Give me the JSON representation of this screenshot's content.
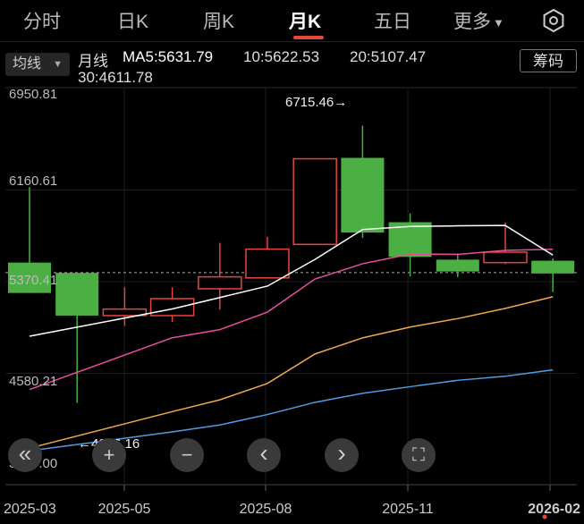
{
  "tabs": [
    {
      "label": "分时",
      "active": false
    },
    {
      "label": "日K",
      "active": false
    },
    {
      "label": "周K",
      "active": false
    },
    {
      "label": "月K",
      "active": true
    },
    {
      "label": "五日",
      "active": false
    },
    {
      "label": "更多",
      "active": false
    }
  ],
  "more_caret": "▼",
  "ma_selector": {
    "label": "均线",
    "caret": "▼"
  },
  "ma_legend": {
    "period": "月线",
    "ma5": "MA5:5631.79",
    "ma10": "10:5622.53",
    "ma20": "20:5107.47",
    "ma30": "30:4611.78"
  },
  "chip_button": "筹码",
  "y_ticks": [
    "6950.81",
    "6160.61",
    "5370.41",
    "4580.21",
    "3790.00"
  ],
  "x_ticks": [
    "2025-03",
    "2025-05",
    "2025-08",
    "2025-11",
    "2026-02"
  ],
  "high_label": "6715.46→",
  "low_label": "←4296.16",
  "controls": {
    "back": "«",
    "zoom_in": "+",
    "zoom_out": "−",
    "prev": "‹",
    "next": "›",
    "fullscreen": "⛶"
  },
  "colors": {
    "up": "#e8453c",
    "down": "#4caf44",
    "ma5": "#ffffff",
    "ma10": "#e54fa0",
    "ma20": "#f0a84e",
    "ma30": "#4e9de6",
    "period": "#f0a84e"
  },
  "chart_data": {
    "type": "candlestick",
    "ylim": [
      3790.0,
      6950.81
    ],
    "reference_price": 5448,
    "candles": [
      {
        "open": 5535,
        "close": 5273,
        "high": 6185,
        "low": 5273,
        "up": false
      },
      {
        "open": 5446,
        "close": 5078,
        "high": 5342,
        "low": 4325,
        "up": false
      },
      {
        "open": 5078,
        "close": 5134,
        "high": 5321,
        "low": 4989,
        "up": true
      },
      {
        "open": 5078,
        "close": 5224,
        "high": 5322,
        "low": 5023,
        "up": true
      },
      {
        "open": 5309,
        "close": 5412,
        "high": 5705,
        "low": 5129,
        "up": true
      },
      {
        "open": 5403,
        "close": 5651,
        "high": 5757,
        "low": 5403,
        "up": true
      },
      {
        "open": 5692,
        "close": 6430,
        "high": 6430,
        "low": 5692,
        "up": true
      },
      {
        "open": 6438,
        "close": 5794,
        "high": 6715,
        "low": 5747,
        "up": false
      },
      {
        "open": 5883,
        "close": 5584,
        "high": 5959,
        "low": 5416,
        "up": false
      },
      {
        "open": 5560,
        "close": 5458,
        "high": 5614,
        "low": 5410,
        "up": false
      },
      {
        "open": 5535,
        "close": 5625,
        "high": 5879,
        "low": 5521,
        "up": true
      },
      {
        "open": 5551,
        "close": 5441,
        "high": 5571,
        "low": 5282,
        "up": false
      }
    ],
    "ma5": [
      4900,
      null,
      null,
      5135,
      null,
      5332,
      5562,
      5820,
      5846,
      5852,
      5855,
      5600
    ],
    "ma10": [
      4440,
      null,
      null,
      4887,
      4957,
      5108,
      5393,
      5525,
      5608,
      5606,
      5640,
      5650
    ],
    "ma20": [
      3935,
      null,
      null,
      4250,
      4352,
      4493,
      4747,
      4886,
      4979,
      5052,
      5140,
      5240
    ],
    "ma30": [
      3912,
      null,
      null,
      4075,
      4135,
      4225,
      4330,
      4408,
      4465,
      4520,
      4555,
      4610
    ]
  }
}
